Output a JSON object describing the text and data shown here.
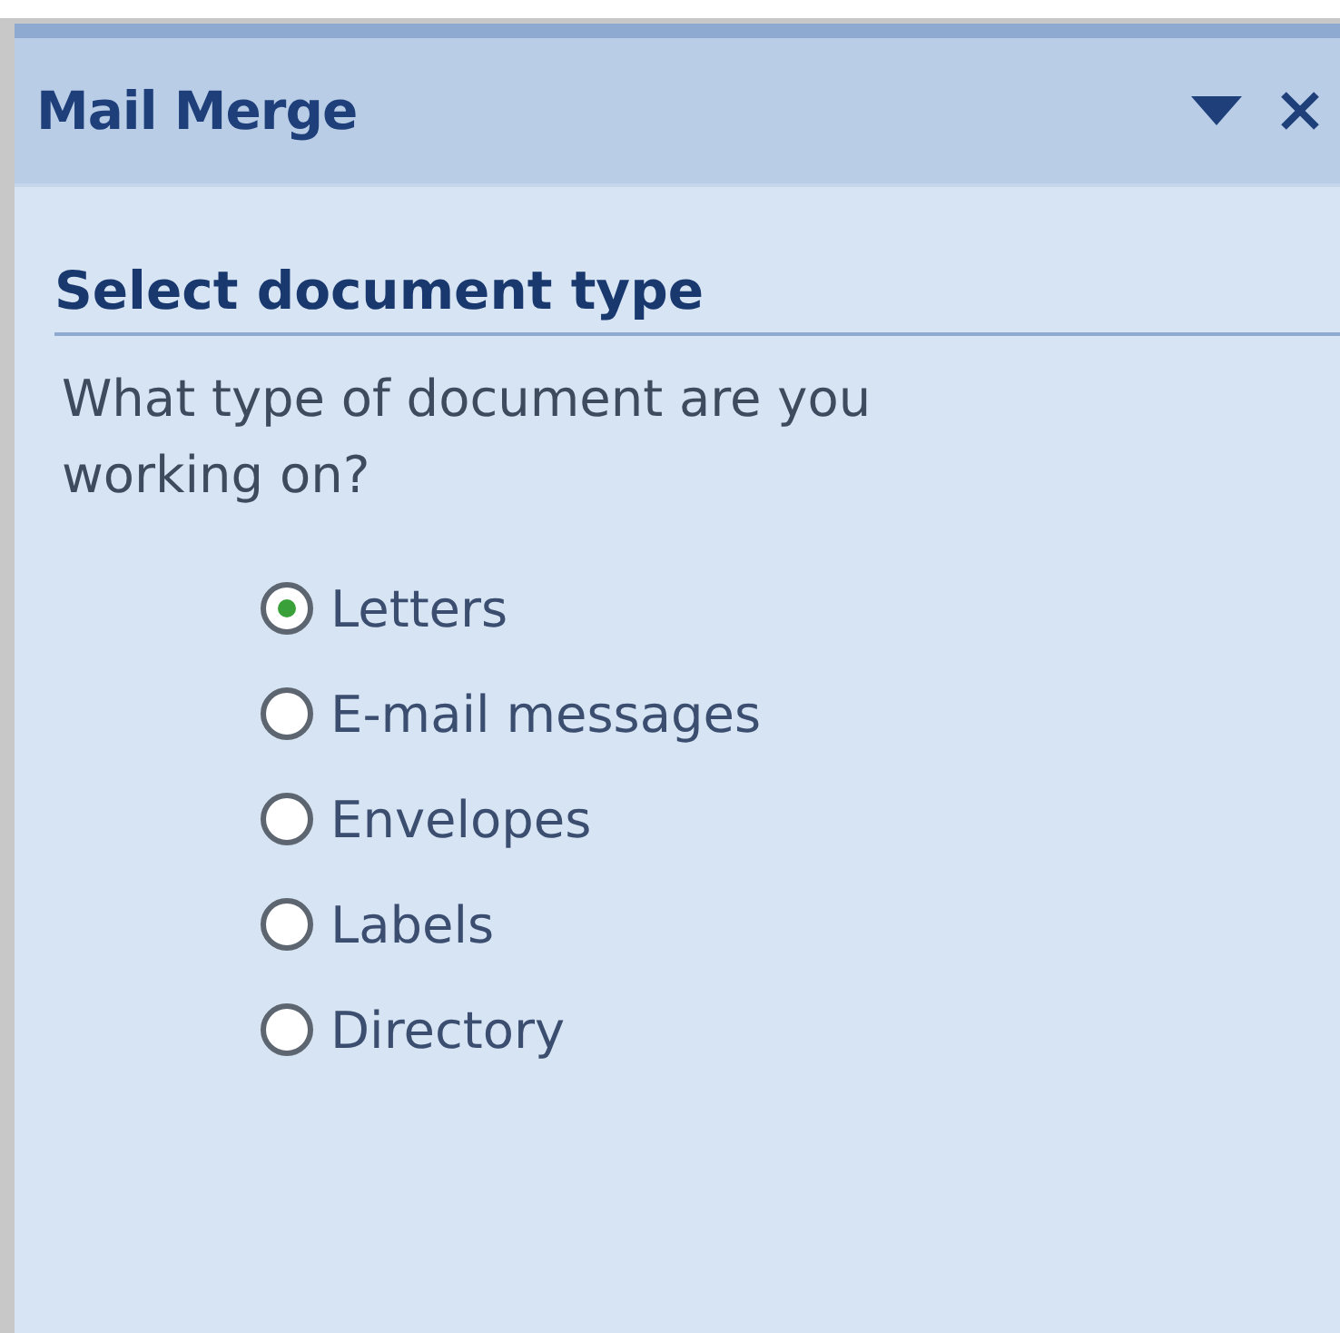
{
  "pane": {
    "title": "Mail Merge"
  },
  "section": {
    "heading": "Select document type",
    "question": "What type of document are you working on?"
  },
  "options": [
    {
      "label": "Letters",
      "selected": true
    },
    {
      "label": "E-mail messages",
      "selected": false
    },
    {
      "label": "Envelopes",
      "selected": false
    },
    {
      "label": "Labels",
      "selected": false
    },
    {
      "label": "Directory",
      "selected": false
    }
  ]
}
